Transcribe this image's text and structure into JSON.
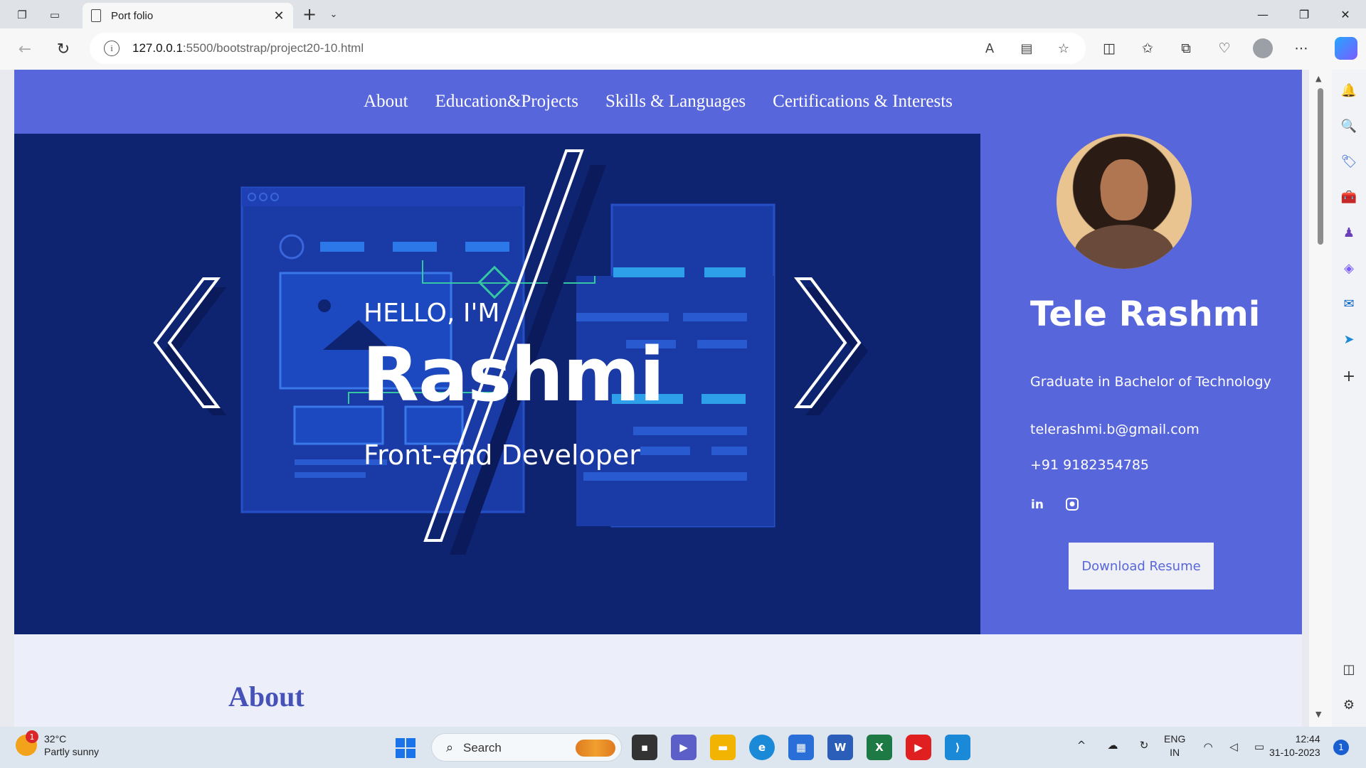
{
  "browser": {
    "tab_title": "Port folio",
    "url_host": "127.0.0.1",
    "url_path": ":5500/bootstrap/project20-10.html"
  },
  "site": {
    "nav": [
      "About",
      "Education&Projects",
      "Skills & Languages",
      "Certifications & Interests"
    ],
    "hero": {
      "greeting": "HELLO, I'M",
      "name": "Rashmi",
      "role": "Front-end Developer"
    },
    "profile": {
      "name": "Tele Rashmi",
      "degree": "Graduate in Bachelor of Technology",
      "email": "telerashmi.b@gmail.com",
      "phone": "+91 9182354785",
      "social_icons": [
        "linkedin-icon",
        "instagram-icon"
      ],
      "button": "Download Resume"
    },
    "about_heading": "About",
    "colors": {
      "nav_bg": "#5866dc",
      "hero_bg": "#0f2470",
      "about_bg": "#eceffa"
    }
  },
  "taskbar": {
    "weather_temp": "32°C",
    "weather_desc": "Partly sunny",
    "weather_badge": "1",
    "search_label": "Search",
    "lang_top": "ENG",
    "lang_bottom": "IN",
    "time": "12:44",
    "date": "31-10-2023",
    "notification_count": "1"
  }
}
